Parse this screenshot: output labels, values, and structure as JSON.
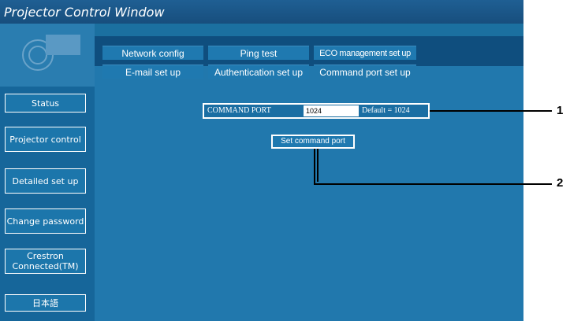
{
  "window": {
    "title": "Projector Control Window"
  },
  "sidebar": {
    "buttons": [
      {
        "label": "Status"
      },
      {
        "label": "Projector control"
      },
      {
        "label": "Detailed set up"
      },
      {
        "label": "Change password"
      },
      {
        "label": "Crestron Connected(TM)"
      },
      {
        "label": "日本語"
      }
    ]
  },
  "tabs": {
    "row1": [
      "Network config",
      "Ping test",
      "ECO management set up"
    ],
    "row2": [
      "E-mail set up",
      "Authentication set up",
      "Command port set up"
    ],
    "active": "Command port set up"
  },
  "command_port": {
    "label": "COMMAND PORT",
    "value": "1024",
    "default_text": "Default = 1024"
  },
  "set_button": {
    "label": "Set command port"
  },
  "callouts": [
    "1",
    "2"
  ],
  "colors": {
    "panel": "#2178ad",
    "sidebar": "#16669a",
    "tabbar": "#0f4e7e",
    "titlebar": "#1f5f93"
  }
}
